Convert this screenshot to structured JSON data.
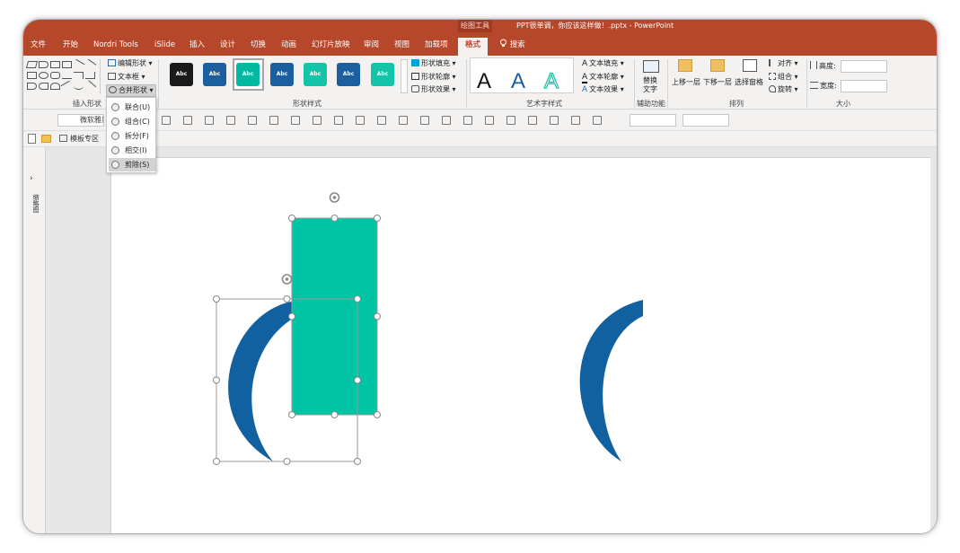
{
  "window": {
    "contextual_group": "绘图工具",
    "title": "PPT很单调，你应该这样做！.pptx  -  PowerPoint"
  },
  "tabs": [
    {
      "label": "文件"
    },
    {
      "label": "开始"
    },
    {
      "label": "Nordri Tools"
    },
    {
      "label": "iSlide"
    },
    {
      "label": "插入"
    },
    {
      "label": "设计"
    },
    {
      "label": "切换"
    },
    {
      "label": "动画"
    },
    {
      "label": "幻灯片放映"
    },
    {
      "label": "审阅"
    },
    {
      "label": "视图"
    },
    {
      "label": "加载项"
    },
    {
      "label": "格式"
    }
  ],
  "search_label": "搜索",
  "ribbon": {
    "insert_shapes": {
      "label": "插入形状",
      "edit_shape": "编辑形状",
      "text_box": "文本框",
      "merge_shapes": "合并形状"
    },
    "shape_styles": {
      "label": "形状样式",
      "thumb_text": "Abc",
      "fill": "形状填充",
      "outline": "形状轮廓",
      "effects": "形状效果",
      "thumb_colors": [
        "#1a1a1a",
        "#1b5f9e",
        "#00b9a0",
        "#1b5f9e",
        "#14c4a8",
        "#1b5f9e",
        "#14c4a8"
      ]
    },
    "wordart": {
      "label": "艺术字样式",
      "letter": "A",
      "text_fill": "文本填充",
      "text_outline": "文本轮廓",
      "text_effects": "文本效果"
    },
    "accessibility": {
      "label": "辅助功能",
      "alt_text_line1": "替换",
      "alt_text_line2": "文字"
    },
    "arrange": {
      "label": "排列",
      "bring_forward": "上移一层",
      "send_backward": "下移一层",
      "selection_pane": "选择窗格",
      "align": "对齐",
      "group": "组合",
      "rotate": "旋转"
    },
    "size": {
      "label": "大小",
      "height": "高度:",
      "width": "宽度:"
    }
  },
  "merge_menu": {
    "items": [
      {
        "label": "联合(U)"
      },
      {
        "label": "组合(C)"
      },
      {
        "label": "拆分(F)"
      },
      {
        "label": "相交(I)"
      },
      {
        "label": "剪除(S)"
      }
    ],
    "highlighted": "剪除(S)"
  },
  "toolbar2": {
    "font_name": "微软雅黑"
  },
  "toolbar3": {
    "template_zone": "模板专区"
  },
  "left_pane": {
    "label": "缩略图"
  },
  "slide": {
    "rect_color": "#00c4a4",
    "crescent_color": "#11609f"
  }
}
